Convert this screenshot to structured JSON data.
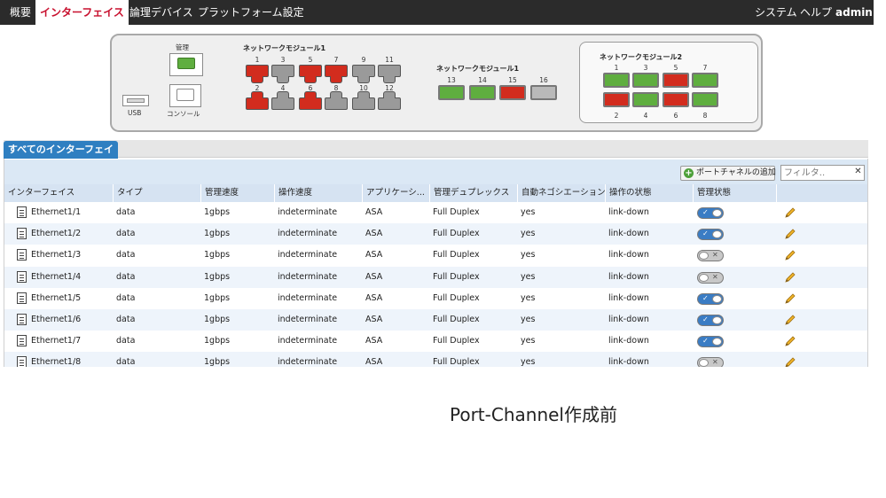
{
  "nav": {
    "tabs": [
      {
        "label": "概要"
      },
      {
        "label": "インターフェイス"
      },
      {
        "label": "論理デバイス"
      },
      {
        "label": "プラットフォーム設定"
      }
    ],
    "right": {
      "system": "システム",
      "help": "ヘルプ",
      "user": "admin"
    }
  },
  "chassis": {
    "mgmt_label": "管理",
    "console_label": "コンソール",
    "usb_label": "USB",
    "module1a": {
      "title": "ネットワークモジュール1",
      "top": [
        {
          "num": "1",
          "status": "red"
        },
        {
          "num": "3",
          "status": "gray"
        },
        {
          "num": "5",
          "status": "red"
        },
        {
          "num": "7",
          "status": "red"
        },
        {
          "num": "9",
          "status": "gray"
        },
        {
          "num": "11",
          "status": "gray"
        }
      ],
      "bottom": [
        {
          "num": "2",
          "status": "red"
        },
        {
          "num": "4",
          "status": "gray"
        },
        {
          "num": "6",
          "status": "red"
        },
        {
          "num": "8",
          "status": "gray"
        },
        {
          "num": "10",
          "status": "gray"
        },
        {
          "num": "12",
          "status": "gray"
        }
      ]
    },
    "module1b": {
      "title": "ネットワークモジュール1",
      "ports": [
        {
          "num": "13",
          "status": "green"
        },
        {
          "num": "14",
          "status": "green"
        },
        {
          "num": "15",
          "status": "red"
        },
        {
          "num": "16",
          "status": "gray"
        }
      ]
    },
    "module2": {
      "title": "ネットワークモジュール2",
      "top": [
        {
          "num": "1",
          "status": "green"
        },
        {
          "num": "3",
          "status": "green"
        },
        {
          "num": "5",
          "status": "red"
        },
        {
          "num": "7",
          "status": "green"
        }
      ],
      "bottom": [
        {
          "num": "2",
          "status": "red"
        },
        {
          "num": "4",
          "status": "green"
        },
        {
          "num": "6",
          "status": "red"
        },
        {
          "num": "8",
          "status": "green"
        }
      ]
    }
  },
  "panel": {
    "tab_label": "すべてのインターフェイス",
    "add_button": "ポートチャネルの追加",
    "filter_placeholder": "フィルタ..",
    "clear_icon": "close-icon",
    "columns": [
      "インターフェイス",
      "タイプ",
      "管理速度",
      "操作速度",
      "アプリケーシ...",
      "管理デュプレックス",
      "自動ネゴシエーション",
      "操作の状態",
      "管理状態",
      ""
    ]
  },
  "rows": [
    {
      "name": "Ethernet1/1",
      "type": "data",
      "admin_speed": "1gbps",
      "oper_speed": "indeterminate",
      "application": "ASA",
      "duplex": "Full Duplex",
      "autoneg": "yes",
      "oper_state": "link-down",
      "admin_state": "enabled"
    },
    {
      "name": "Ethernet1/2",
      "type": "data",
      "admin_speed": "1gbps",
      "oper_speed": "indeterminate",
      "application": "ASA",
      "duplex": "Full Duplex",
      "autoneg": "yes",
      "oper_state": "link-down",
      "admin_state": "enabled"
    },
    {
      "name": "Ethernet1/3",
      "type": "data",
      "admin_speed": "1gbps",
      "oper_speed": "indeterminate",
      "application": "ASA",
      "duplex": "Full Duplex",
      "autoneg": "yes",
      "oper_state": "link-down",
      "admin_state": "disabled"
    },
    {
      "name": "Ethernet1/4",
      "type": "data",
      "admin_speed": "1gbps",
      "oper_speed": "indeterminate",
      "application": "ASA",
      "duplex": "Full Duplex",
      "autoneg": "yes",
      "oper_state": "link-down",
      "admin_state": "disabled"
    },
    {
      "name": "Ethernet1/5",
      "type": "data",
      "admin_speed": "1gbps",
      "oper_speed": "indeterminate",
      "application": "ASA",
      "duplex": "Full Duplex",
      "autoneg": "yes",
      "oper_state": "link-down",
      "admin_state": "enabled"
    },
    {
      "name": "Ethernet1/6",
      "type": "data",
      "admin_speed": "1gbps",
      "oper_speed": "indeterminate",
      "application": "ASA",
      "duplex": "Full Duplex",
      "autoneg": "yes",
      "oper_state": "link-down",
      "admin_state": "enabled"
    },
    {
      "name": "Ethernet1/7",
      "type": "data",
      "admin_speed": "1gbps",
      "oper_speed": "indeterminate",
      "application": "ASA",
      "duplex": "Full Duplex",
      "autoneg": "yes",
      "oper_state": "link-down",
      "admin_state": "enabled"
    },
    {
      "name": "Ethernet1/8",
      "type": "data",
      "admin_speed": "1gbps",
      "oper_speed": "indeterminate",
      "application": "ASA",
      "duplex": "Full Duplex",
      "autoneg": "yes",
      "oper_state": "link-down",
      "admin_state": "disabled"
    }
  ],
  "caption": "Port-Channel作成前",
  "colors": {
    "accent_red": "#c8102e",
    "port_red": "#d22c1e",
    "port_green": "#5fae3f",
    "port_gray": "#9a9a9a",
    "toggle_on": "#3a7cc4",
    "nav_bg": "#2b2b2b"
  }
}
